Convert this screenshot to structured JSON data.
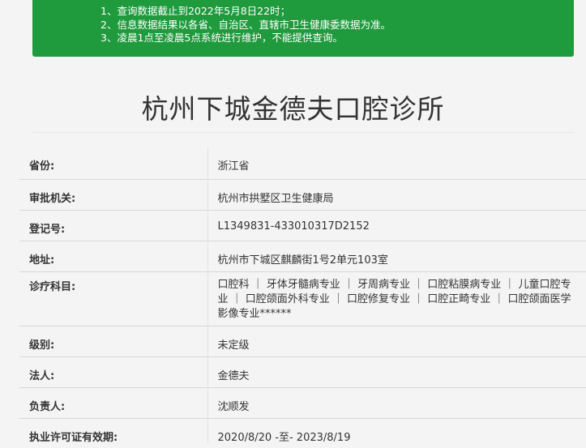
{
  "notice": {
    "lines": [
      "1、查询数据截止到2022年5月8日22时；",
      "2、信息数据结果以各省、自治区、直辖市卫生健康委数据为准。",
      "3、凌晨1点至凌晨5点系统进行维护，不能提供查询。"
    ]
  },
  "page": {
    "title": "杭州下城金德夫口腔诊所"
  },
  "details": [
    {
      "label": "省份:",
      "value": "浙江省"
    },
    {
      "label": "审批机关:",
      "value": "杭州市拱墅区卫生健康局"
    },
    {
      "label": "登记号:",
      "value": "L1349831-433010317D2152"
    },
    {
      "label": "地址:",
      "value": "杭州市下城区麒麟街1号2单元103室"
    },
    {
      "label": "诊疗科目:",
      "value": "口腔科 ｜ 牙体牙髓病专业 ｜ 牙周病专业 ｜ 口腔粘膜病专业 ｜ 儿童口腔专业 ｜ 口腔颌面外科专业 ｜ 口腔修复专业 ｜ 口腔正畸专业 ｜ 口腔颌面医学影像专业******"
    },
    {
      "label": "级别:",
      "value": "未定级"
    },
    {
      "label": "法人:",
      "value": "金德夫"
    },
    {
      "label": "负责人:",
      "value": "沈顺发"
    },
    {
      "label": "执业许可证有效期:",
      "value": "2020/8/20 -至- 2023/8/19"
    }
  ]
}
